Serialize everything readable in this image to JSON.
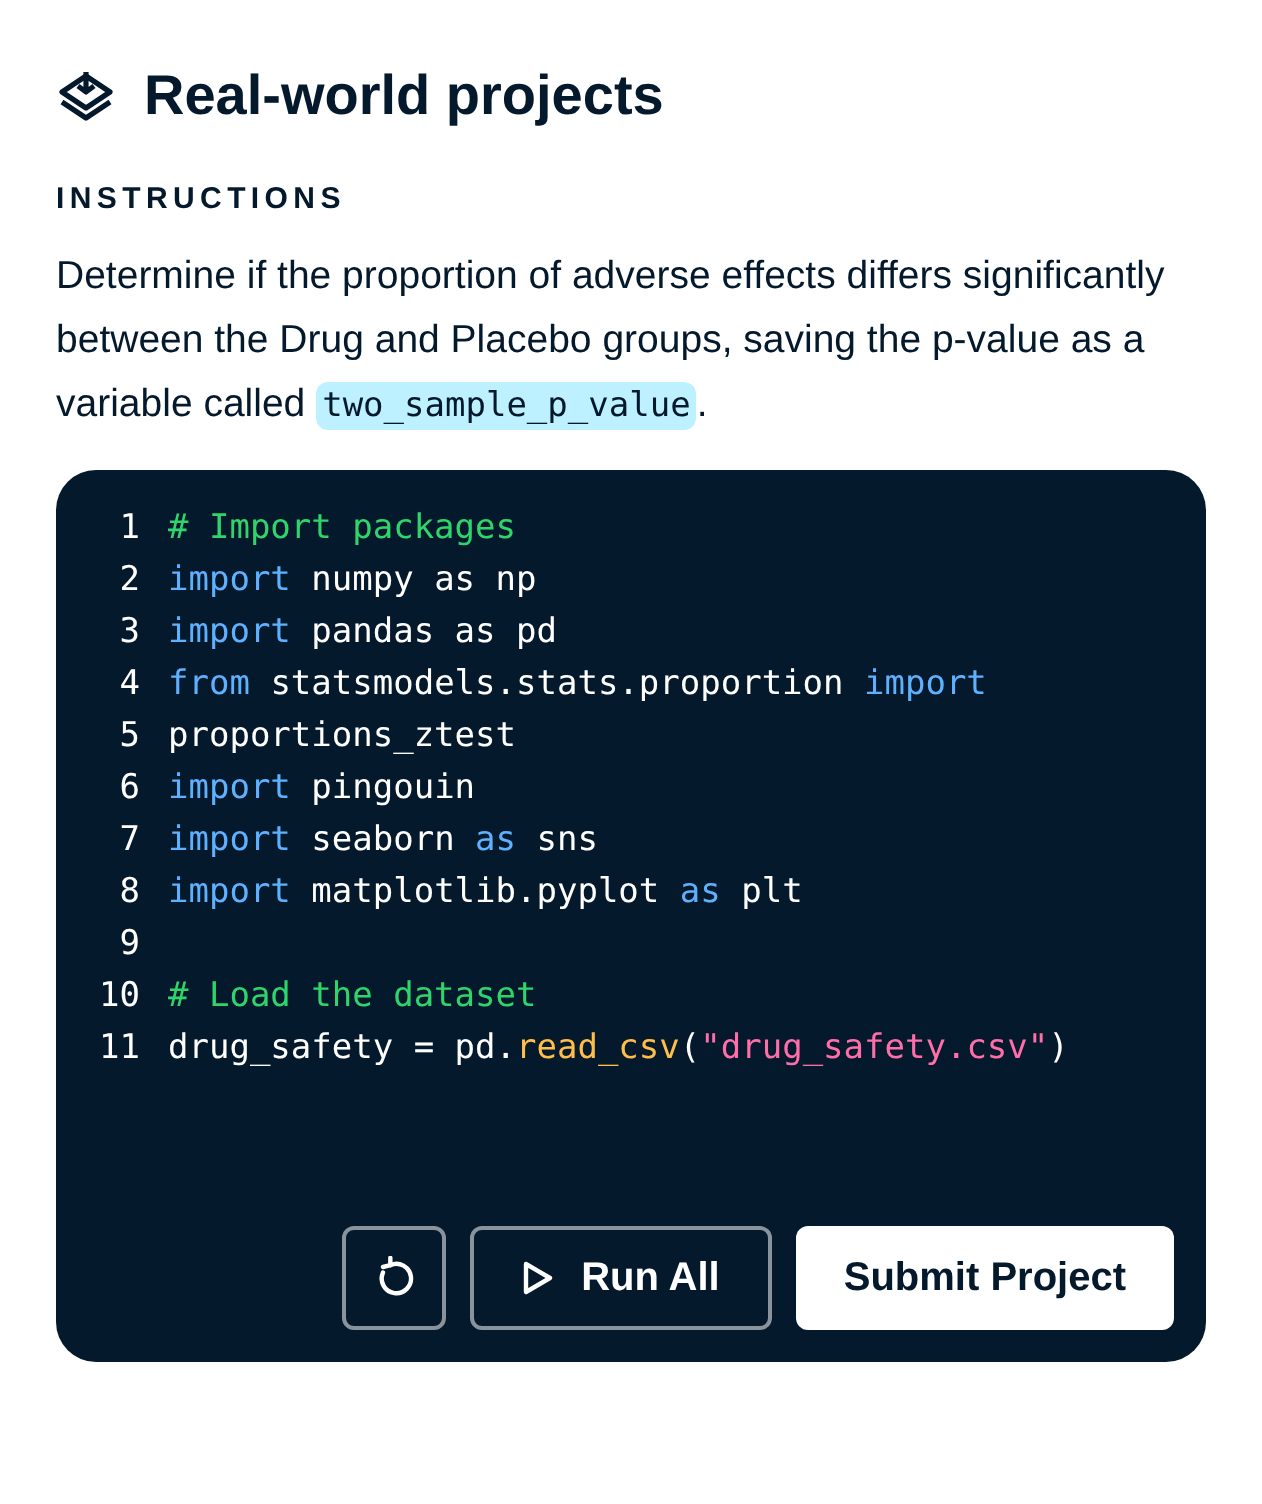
{
  "header": {
    "title": "Real-world projects"
  },
  "instructions": {
    "label": "INSTRUCTIONS",
    "text": "Determine if the proportion of adverse effects differs significantly between the Drug and Placebo groups, saving the p-value as a variable called",
    "code": "two_sample_p_value",
    "after": "."
  },
  "code_lines": [
    {
      "number": "1",
      "tokens": [
        {
          "kind": "comment",
          "text": "# Import packages"
        }
      ]
    },
    {
      "number": "2",
      "tokens": [
        {
          "kind": "keyword",
          "text": "import"
        },
        {
          "kind": "plain",
          "text": " numpy as np"
        }
      ]
    },
    {
      "number": "3",
      "tokens": [
        {
          "kind": "keyword",
          "text": "import"
        },
        {
          "kind": "plain",
          "text": " pandas as pd"
        }
      ]
    },
    {
      "number": "4",
      "tokens": [
        {
          "kind": "keyword",
          "text": "from"
        },
        {
          "kind": "plain",
          "text": " statsmodels.stats.proportion "
        },
        {
          "kind": "keyword",
          "text": "import"
        }
      ]
    },
    {
      "number": "5",
      "tokens": [
        {
          "kind": "plain",
          "text": "proportions_ztest"
        }
      ]
    },
    {
      "number": "6",
      "tokens": [
        {
          "kind": "keyword",
          "text": "import"
        },
        {
          "kind": "plain",
          "text": " pingouin"
        }
      ]
    },
    {
      "number": "7",
      "tokens": [
        {
          "kind": "keyword",
          "text": "import"
        },
        {
          "kind": "plain",
          "text": " seaborn "
        },
        {
          "kind": "keyword",
          "text": "as"
        },
        {
          "kind": "plain",
          "text": " sns"
        }
      ]
    },
    {
      "number": "8",
      "tokens": [
        {
          "kind": "keyword",
          "text": "import"
        },
        {
          "kind": "plain",
          "text": " matplotlib.pyplot "
        },
        {
          "kind": "keyword",
          "text": "as"
        },
        {
          "kind": "plain",
          "text": " plt"
        }
      ]
    },
    {
      "number": "9"
    },
    {
      "number": "10",
      "tokens": [
        {
          "kind": "comment",
          "text": "# Load the dataset"
        }
      ]
    },
    {
      "number": "11",
      "tokens": [
        {
          "kind": "plain",
          "text": "drug_safety = pd."
        },
        {
          "kind": "function",
          "text": "read_csv"
        },
        {
          "kind": "plain",
          "text": "("
        },
        {
          "kind": "string",
          "text": "\"drug_safety.csv\""
        },
        {
          "kind": "plain",
          "text": ")"
        }
      ]
    }
  ],
  "buttons": {
    "run_all": "Run All",
    "submit": "Submit Project"
  }
}
